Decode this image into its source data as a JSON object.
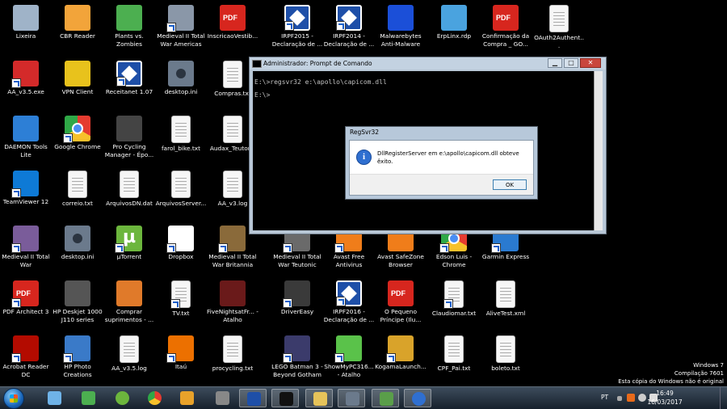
{
  "desktop": {
    "icons": [
      {
        "label": "Lixeira",
        "glyph": "recycle-bin-icon",
        "color": "#9fb3c8"
      },
      {
        "label": "CBR Reader",
        "glyph": "cbr-reader-icon",
        "color": "#f2a43a"
      },
      {
        "label": "Plants vs. Zombies",
        "glyph": "plants-vs-zombies-icon",
        "color": "#4caf50"
      },
      {
        "label": "Medieval II Total War Americas",
        "glyph": "medieval-game-icon",
        "color": "#8a97a8"
      },
      {
        "label": "InscricaoVestib...",
        "glyph": "pdf-icon",
        "color": "#d7261e"
      },
      {
        "label": "IRPF2015 - Declaração de ...",
        "glyph": "irpf-icon",
        "color": "#1e4fa8"
      },
      {
        "label": "IRPF2014 - Declaração de ...",
        "glyph": "irpf-icon",
        "color": "#1e4fa8"
      },
      {
        "label": "Malwarebytes Anti-Malware",
        "glyph": "malwarebytes-icon",
        "color": "#1b4fd8"
      },
      {
        "label": "ErpLinx.rdp",
        "glyph": "remote-desktop-icon",
        "color": "#4aa3df"
      },
      {
        "label": "Confirmação da Compra _ GO...",
        "glyph": "pdf-icon",
        "color": "#d7261e"
      },
      {
        "label": "OAuth2Authent...",
        "glyph": "document-icon",
        "color": "#f6f6f6"
      },
      {
        "label": "AA_v3.5.exe",
        "glyph": "ammyy-admin-icon",
        "color": "#d42a2a"
      },
      {
        "label": "VPN Client",
        "glyph": "vpn-icon",
        "color": "#e8c21c"
      },
      {
        "label": "Receitanet 1.07",
        "glyph": "receitanet-icon",
        "color": "#1e4fa8"
      },
      {
        "label": "desktop.ini",
        "glyph": "gear-file-icon",
        "color": "#6b7a8c"
      },
      {
        "label": "Compras.txt",
        "glyph": "document-icon",
        "color": "#f6f6f6"
      },
      {
        "label": "DAEMON Tools Lite",
        "glyph": "daemon-tools-icon",
        "color": "#2d7fd6"
      },
      {
        "label": "Google Chrome",
        "glyph": "chrome-icon",
        "color": "#4a8ef3"
      },
      {
        "label": "Pro Cycling Manager - Épo...",
        "glyph": "cycling-game-icon",
        "color": "#444"
      },
      {
        "label": "farol_bike.txt",
        "glyph": "document-icon",
        "color": "#f6f6f6"
      },
      {
        "label": "Audax_Teutor...",
        "glyph": "document-icon",
        "color": "#f6f6f6"
      },
      {
        "label": "TeamViewer 12",
        "glyph": "teamviewer-icon",
        "color": "#0e7ad6"
      },
      {
        "label": "correio.txt",
        "glyph": "document-icon",
        "color": "#f6f6f6"
      },
      {
        "label": "ArquivosDN.dat",
        "glyph": "data-file-icon",
        "color": "#f6f6f6"
      },
      {
        "label": "ArquivosServer...",
        "glyph": "data-file-icon",
        "color": "#f6f6f6"
      },
      {
        "label": "AA_v3.log",
        "glyph": "document-icon",
        "color": "#f6f6f6"
      },
      {
        "label": "Medieval II Total War",
        "glyph": "medieval-game-icon",
        "color": "#7a5c9a"
      },
      {
        "label": "desktop.ini",
        "glyph": "gear-file-icon",
        "color": "#6b7a8c"
      },
      {
        "label": "µTorrent",
        "glyph": "utorrent-icon",
        "color": "#6cb63d"
      },
      {
        "label": "Dropbox",
        "glyph": "dropbox-icon",
        "color": "#ffffff"
      },
      {
        "label": "Medieval II Total War Britannia",
        "glyph": "medieval-game-icon",
        "color": "#8a6a3a"
      },
      {
        "label": "Medieval II Total War Teutonic",
        "glyph": "medieval-game-icon",
        "color": "#6a6a6a"
      },
      {
        "label": "Avast Free Antivirus",
        "glyph": "avast-icon",
        "color": "#f07d1a"
      },
      {
        "label": "Avast SafeZone Browser",
        "glyph": "avast-icon",
        "color": "#f07d1a"
      },
      {
        "label": "Edson Luis - Chrome",
        "glyph": "chrome-user-icon",
        "color": "#3a6fc4"
      },
      {
        "label": "Garmin Express",
        "glyph": "garmin-icon",
        "color": "#2a7ad0"
      },
      {
        "label": "PDF Architect 3",
        "glyph": "pdf-icon",
        "color": "#d7261e"
      },
      {
        "label": "HP Deskjet 1000 J110 series",
        "glyph": "printer-icon",
        "color": "#555"
      },
      {
        "label": "Comprar suprimentos - ...",
        "glyph": "printer-supplies-icon",
        "color": "#e07a2a"
      },
      {
        "label": "TV.txt",
        "glyph": "document-icon",
        "color": "#f6f6f6"
      },
      {
        "label": "FiveNightsatFr... - Atalho",
        "glyph": "fnaf-game-icon",
        "color": "#6a1a1a"
      },
      {
        "label": "DriverEasy",
        "glyph": "drivereasy-icon",
        "color": "#3a3a3a"
      },
      {
        "label": "IRPF2016 - Declaração de ...",
        "glyph": "irpf-icon",
        "color": "#1e4fa8"
      },
      {
        "label": "O Pequeno Príncipe (Ilu...",
        "glyph": "pdf-icon",
        "color": "#d7261e"
      },
      {
        "label": "Claudiomar.txt",
        "glyph": "document-icon",
        "color": "#f6f6f6"
      },
      {
        "label": "AliveTest.xml",
        "glyph": "xml-file-icon",
        "color": "#f6f6f6"
      },
      {
        "label": "Acrobat Reader DC",
        "glyph": "acrobat-icon",
        "color": "#b30b00"
      },
      {
        "label": "HP Photo Creations",
        "glyph": "photo-icon",
        "color": "#3a7ac8"
      },
      {
        "label": "AA_v3.5.log",
        "glyph": "document-icon",
        "color": "#f6f6f6"
      },
      {
        "label": "Itaú",
        "glyph": "itau-icon",
        "color": "#ec7000"
      },
      {
        "label": "procycling.txt",
        "glyph": "document-icon",
        "color": "#f6f6f6"
      },
      {
        "label": "LEGO Batman 3 - Beyond Gotham",
        "glyph": "lego-batman-icon",
        "color": "#3b3b6b"
      },
      {
        "label": "ShowMyPC316... - Atalho",
        "glyph": "showmypc-icon",
        "color": "#5ac24a"
      },
      {
        "label": "KogamaLaunch...",
        "glyph": "kogama-icon",
        "color": "#d9a32a"
      },
      {
        "label": "CPF_Pai.txt",
        "glyph": "document-icon",
        "color": "#f6f6f6"
      },
      {
        "label": "boleto.txt",
        "glyph": "document-icon",
        "color": "#f6f6f6"
      }
    ]
  },
  "cmd_window": {
    "title": "Administrador: Prompt de Comando",
    "lines": [
      "E:\\>regsvr32 e:\\apollo\\capicom.dll",
      "",
      "E:\\>"
    ],
    "minimize": "▁",
    "maximize": "□",
    "close": "✕"
  },
  "dialog": {
    "title": "RegSvr32",
    "message": "DllRegisterServer em e:\\apollo\\capicom.dll  obteve êxito.",
    "ok_label": "OK",
    "icon": "information-icon"
  },
  "watermark": {
    "line1": "Windows 7",
    "line2": "Compilação 7601",
    "line3": "Esta cópia do Windows não é original"
  },
  "taskbar": {
    "pinned": [
      {
        "name": "taskbar-windows-explorer-libraries",
        "color": "#6fb3e8"
      },
      {
        "name": "taskbar-plants-vs-zombies",
        "color": "#4caf50"
      },
      {
        "name": "taskbar-utorrent",
        "color": "#6cb63d"
      },
      {
        "name": "taskbar-google-chrome",
        "color": "#4a8ef3"
      },
      {
        "name": "taskbar-media-player",
        "color": "#e8a22a"
      },
      {
        "name": "taskbar-hp-printer",
        "color": "#888"
      },
      {
        "name": "taskbar-remote-desktop",
        "color": "#1e4fa8"
      },
      {
        "name": "taskbar-command-prompt",
        "color": "#111"
      },
      {
        "name": "taskbar-windows-explorer",
        "color": "#e6c35a"
      },
      {
        "name": "taskbar-control-panel",
        "color": "#6b7a8c"
      },
      {
        "name": "taskbar-network",
        "color": "#5a9e4a"
      },
      {
        "name": "taskbar-regsvr32-info",
        "color": "#2f6fd0"
      }
    ],
    "language": "PT",
    "time": "16:49",
    "date": "16/03/2017"
  }
}
